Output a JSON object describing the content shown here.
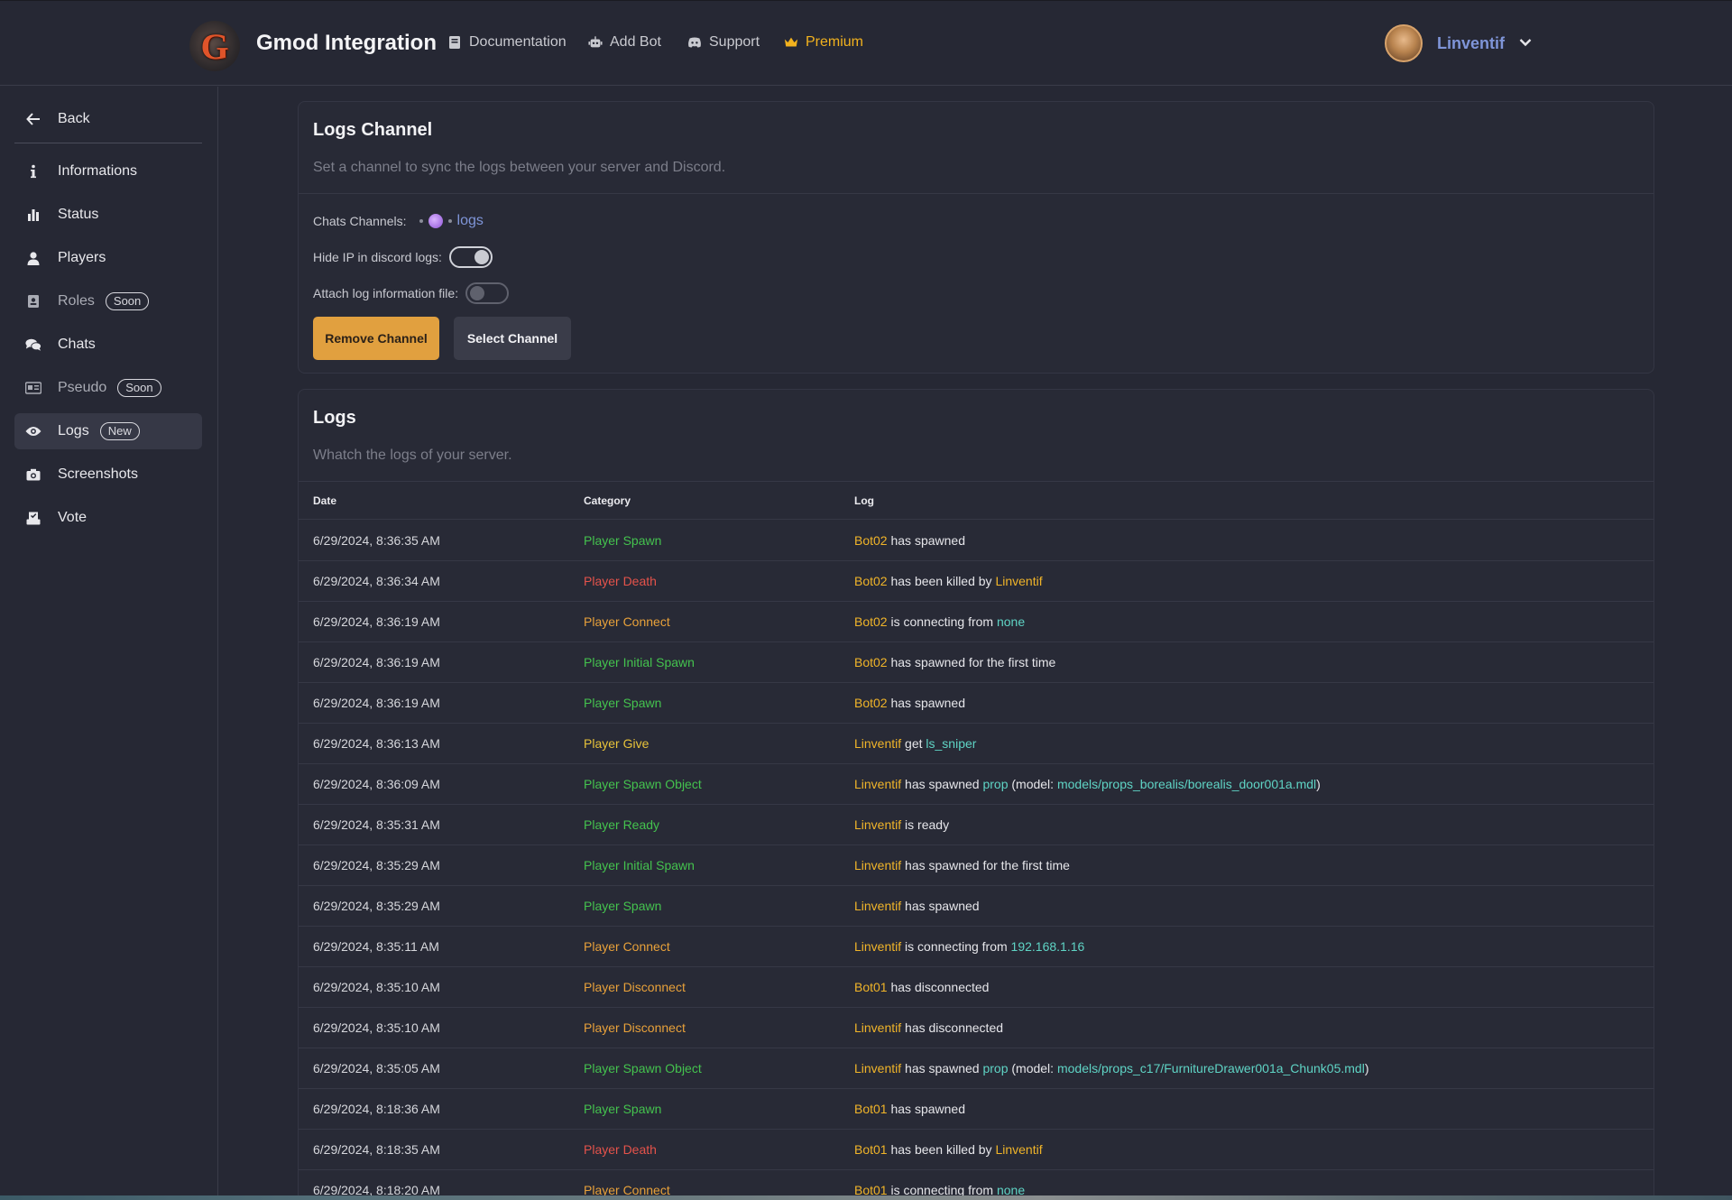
{
  "header": {
    "logo_letter": "G",
    "title": "Gmod Integration",
    "nav": [
      {
        "label": "Documentation",
        "icon": "book-icon"
      },
      {
        "label": "Add Bot",
        "icon": "robot-icon"
      },
      {
        "label": "Support",
        "icon": "discord-icon"
      },
      {
        "label": "Premium",
        "icon": "crown-icon",
        "color": "#f2b21e"
      }
    ],
    "user": {
      "name": "Linventif"
    }
  },
  "sidebar": {
    "back_label": "Back",
    "items": [
      {
        "label": "Informations",
        "icon": "info-icon"
      },
      {
        "label": "Status",
        "icon": "bar-chart-icon"
      },
      {
        "label": "Players",
        "icon": "user-icon"
      },
      {
        "label": "Roles",
        "icon": "id-badge-icon",
        "badge": "Soon"
      },
      {
        "label": "Chats",
        "icon": "chat-icon"
      },
      {
        "label": "Pseudo",
        "icon": "id-card-icon",
        "badge": "Soon"
      },
      {
        "label": "Logs",
        "icon": "eye-icon",
        "badge": "New"
      },
      {
        "label": "Screenshots",
        "icon": "camera-icon"
      },
      {
        "label": "Vote",
        "icon": "vote-box-icon"
      }
    ]
  },
  "logs_channel": {
    "title": "Logs Channel",
    "subtitle": "Set a channel to sync the logs between your server and Discord.",
    "channels_label": "Chats Channels:",
    "channel_name": "logs",
    "hide_ip_label": "Hide IP in discord logs:",
    "hide_ip_enabled": true,
    "attach_label": "Attach log information file:",
    "attach_enabled": false,
    "remove_button": "Remove Channel",
    "select_button": "Select Channel"
  },
  "logs": {
    "title": "Logs",
    "subtitle": "Whatch the logs of your server.",
    "columns": [
      "Date",
      "Category",
      "Log"
    ],
    "rows": [
      {
        "date": "6/29/2024, 8:36:35 AM",
        "category": "Player Spawn",
        "cat_color": "green",
        "log": [
          {
            "t": "Bot02",
            "c": "y"
          },
          {
            "t": " has spawned"
          }
        ]
      },
      {
        "date": "6/29/2024, 8:36:34 AM",
        "category": "Player Death",
        "cat_color": "red",
        "log": [
          {
            "t": "Bot02",
            "c": "y"
          },
          {
            "t": " has been killed by "
          },
          {
            "t": "Linventif",
            "c": "y"
          }
        ]
      },
      {
        "date": "6/29/2024, 8:36:19 AM",
        "category": "Player Connect",
        "cat_color": "orange",
        "log": [
          {
            "t": "Bot02",
            "c": "y"
          },
          {
            "t": " is connecting from "
          },
          {
            "t": "none",
            "c": "c"
          }
        ]
      },
      {
        "date": "6/29/2024, 8:36:19 AM",
        "category": "Player Initial Spawn",
        "cat_color": "green",
        "log": [
          {
            "t": "Bot02",
            "c": "y"
          },
          {
            "t": " has spawned for the first time"
          }
        ]
      },
      {
        "date": "6/29/2024, 8:36:19 AM",
        "category": "Player Spawn",
        "cat_color": "green",
        "log": [
          {
            "t": "Bot02",
            "c": "y"
          },
          {
            "t": " has spawned"
          }
        ]
      },
      {
        "date": "6/29/2024, 8:36:13 AM",
        "category": "Player Give",
        "cat_color": "yellow",
        "log": [
          {
            "t": "Linventif",
            "c": "y"
          },
          {
            "t": " get "
          },
          {
            "t": "ls_sniper",
            "c": "c"
          }
        ]
      },
      {
        "date": "6/29/2024, 8:36:09 AM",
        "category": "Player Spawn Object",
        "cat_color": "green",
        "log": [
          {
            "t": "Linventif",
            "c": "y"
          },
          {
            "t": " has spawned "
          },
          {
            "t": "prop",
            "c": "c"
          },
          {
            "t": " (model: "
          },
          {
            "t": "models/props_borealis/borealis_door001a.mdl",
            "c": "c"
          },
          {
            "t": ")"
          }
        ]
      },
      {
        "date": "6/29/2024, 8:35:31 AM",
        "category": "Player Ready",
        "cat_color": "green",
        "log": [
          {
            "t": "Linventif",
            "c": "y"
          },
          {
            "t": " is ready"
          }
        ]
      },
      {
        "date": "6/29/2024, 8:35:29 AM",
        "category": "Player Initial Spawn",
        "cat_color": "green",
        "log": [
          {
            "t": "Linventif",
            "c": "y"
          },
          {
            "t": " has spawned for the first time"
          }
        ]
      },
      {
        "date": "6/29/2024, 8:35:29 AM",
        "category": "Player Spawn",
        "cat_color": "green",
        "log": [
          {
            "t": "Linventif",
            "c": "y"
          },
          {
            "t": " has spawned"
          }
        ]
      },
      {
        "date": "6/29/2024, 8:35:11 AM",
        "category": "Player Connect",
        "cat_color": "orange",
        "log": [
          {
            "t": "Linventif",
            "c": "y"
          },
          {
            "t": " is connecting from "
          },
          {
            "t": "192.168.1.16",
            "c": "c"
          }
        ]
      },
      {
        "date": "6/29/2024, 8:35:10 AM",
        "category": "Player Disconnect",
        "cat_color": "orange",
        "log": [
          {
            "t": "Bot01",
            "c": "y"
          },
          {
            "t": " has disconnected"
          }
        ]
      },
      {
        "date": "6/29/2024, 8:35:10 AM",
        "category": "Player Disconnect",
        "cat_color": "orange",
        "log": [
          {
            "t": "Linventif",
            "c": "y"
          },
          {
            "t": " has disconnected"
          }
        ]
      },
      {
        "date": "6/29/2024, 8:35:05 AM",
        "category": "Player Spawn Object",
        "cat_color": "green",
        "log": [
          {
            "t": "Linventif",
            "c": "y"
          },
          {
            "t": " has spawned "
          },
          {
            "t": "prop",
            "c": "c"
          },
          {
            "t": " (model: "
          },
          {
            "t": "models/props_c17/FurnitureDrawer001a_Chunk05.mdl",
            "c": "c"
          },
          {
            "t": ")"
          }
        ]
      },
      {
        "date": "6/29/2024, 8:18:36 AM",
        "category": "Player Spawn",
        "cat_color": "green",
        "log": [
          {
            "t": "Bot01",
            "c": "y"
          },
          {
            "t": " has spawned"
          }
        ]
      },
      {
        "date": "6/29/2024, 8:18:35 AM",
        "category": "Player Death",
        "cat_color": "red",
        "log": [
          {
            "t": "Bot01",
            "c": "y"
          },
          {
            "t": " has been killed by "
          },
          {
            "t": "Linventif",
            "c": "y"
          }
        ]
      },
      {
        "date": "6/29/2024, 8:18:20 AM",
        "category": "Player Connect",
        "cat_color": "orange",
        "log": [
          {
            "t": "Bot01",
            "c": "y"
          },
          {
            "t": " is connecting from "
          },
          {
            "t": "none",
            "c": "c"
          }
        ]
      }
    ]
  },
  "colors": {
    "background": "#262834",
    "accent": "#e1a03f",
    "premium": "#f2b21e",
    "link": "#7f95d8",
    "green": "#44c24e",
    "red": "#e5534b",
    "orange": "#e8a13a",
    "yellow": "#e8c33a",
    "highlight_name": "#f0b429",
    "highlight_value": "#5fd4c5"
  }
}
